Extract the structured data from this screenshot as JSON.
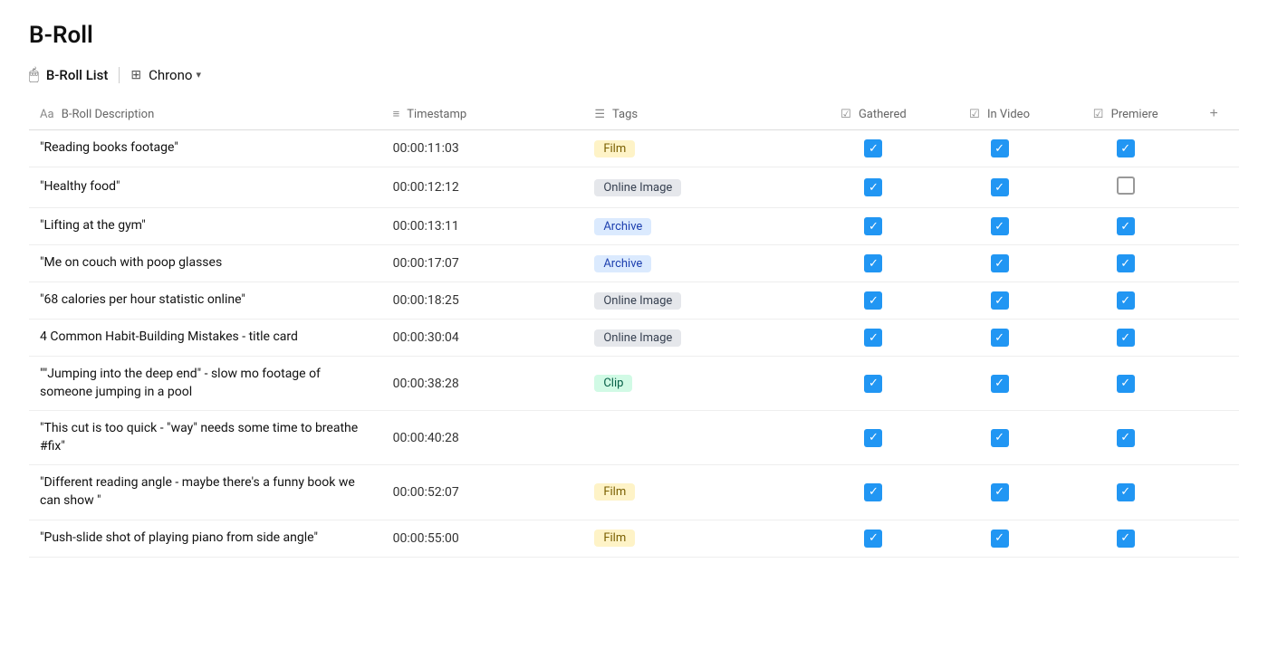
{
  "page": {
    "title": "B-Roll",
    "toolbar": {
      "icon": "🖱",
      "list_label": "B-Roll List",
      "view_icon": "⊞",
      "chrono_label": "Chrono",
      "chevron": "▾"
    },
    "table": {
      "columns": [
        {
          "id": "description",
          "icon": "Aa",
          "label": "B-Roll Description"
        },
        {
          "id": "timestamp",
          "icon": "≡",
          "label": "Timestamp"
        },
        {
          "id": "tags",
          "icon": "☰",
          "label": "Tags"
        },
        {
          "id": "gathered",
          "icon": "☑",
          "label": "Gathered"
        },
        {
          "id": "invideo",
          "icon": "☑",
          "label": "In Video"
        },
        {
          "id": "premiere",
          "icon": "☑",
          "label": "Premiere"
        },
        {
          "id": "add",
          "icon": "+",
          "label": ""
        }
      ],
      "rows": [
        {
          "description": "\"Reading books footage\"",
          "timestamp": "00:00:11:03",
          "tag": "Film",
          "tag_type": "film",
          "gathered": true,
          "invideo": true,
          "premiere": true
        },
        {
          "description": "\"Healthy food\"",
          "timestamp": "00:00:12:12",
          "tag": "Online Image",
          "tag_type": "online-image",
          "gathered": true,
          "invideo": true,
          "premiere": false
        },
        {
          "description": "\"Lifting at the gym\"",
          "timestamp": "00:00:13:11",
          "tag": "Archive",
          "tag_type": "archive",
          "gathered": true,
          "invideo": true,
          "premiere": true
        },
        {
          "description": "\"Me on couch with poop glasses",
          "timestamp": "00:00:17:07",
          "tag": "Archive",
          "tag_type": "archive",
          "gathered": true,
          "invideo": true,
          "premiere": true
        },
        {
          "description": "\"68 calories per hour statistic online\"",
          "timestamp": "00:00:18:25",
          "tag": "Online Image",
          "tag_type": "online-image",
          "gathered": true,
          "invideo": true,
          "premiere": true
        },
        {
          "description": "4 Common Habit-Building Mistakes - title card",
          "timestamp": "00:00:30:04",
          "tag": "Online Image",
          "tag_type": "online-image",
          "gathered": true,
          "invideo": true,
          "premiere": true
        },
        {
          "description": "\"\"Jumping into the deep end\" - slow mo footage of someone jumping in a pool",
          "timestamp": "00:00:38:28",
          "tag": "Clip",
          "tag_type": "clip",
          "gathered": true,
          "invideo": true,
          "premiere": true
        },
        {
          "description": "\"This cut is too quick - \"way\" needs some time to breathe #fix\"",
          "timestamp": "00:00:40:28",
          "tag": "",
          "tag_type": "",
          "gathered": true,
          "invideo": true,
          "premiere": true
        },
        {
          "description": "\"Different reading angle - maybe there's a funny book we can show \"",
          "timestamp": "00:00:52:07",
          "tag": "Film",
          "tag_type": "film",
          "gathered": true,
          "invideo": true,
          "premiere": true
        },
        {
          "description": "\"Push-slide shot of playing piano from side angle\"",
          "timestamp": "00:00:55:00",
          "tag": "Film",
          "tag_type": "film",
          "gathered": true,
          "invideo": true,
          "premiere": true
        }
      ]
    }
  }
}
